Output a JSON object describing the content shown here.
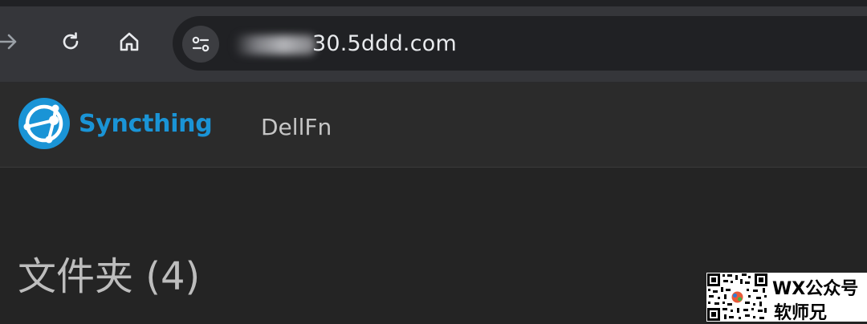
{
  "browser": {
    "url_visible": "30.5ddd.com",
    "buttons": {
      "forward": "forward-arrow-icon",
      "reload": "reload-icon",
      "home": "home-icon",
      "site_info": "tune-icon"
    }
  },
  "navbar": {
    "brand_name": "Syncthing",
    "device_name": "DellFn",
    "brand_color": "#1a94d6"
  },
  "main": {
    "section_title": "文件夹 (4)"
  },
  "watermark": {
    "line1": "WX公众号",
    "line2": "软师兄"
  }
}
